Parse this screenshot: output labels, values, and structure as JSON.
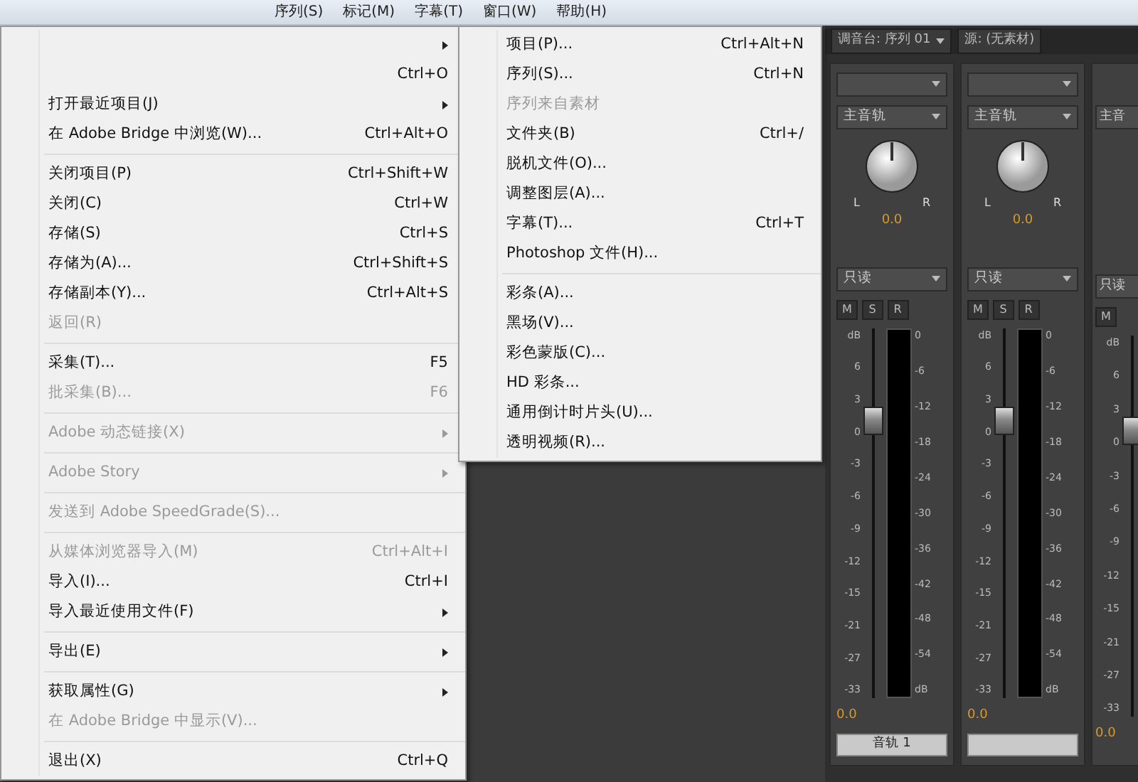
{
  "menu_bar": [
    {
      "label": "序列(S)"
    },
    {
      "label": "标记(M)"
    },
    {
      "label": "字幕(T)"
    },
    {
      "label": "窗口(W)"
    },
    {
      "label": "帮助(H)"
    }
  ],
  "file_menu": {
    "items": [
      {
        "kind": "item",
        "submenu": true,
        "disabled": false
      },
      {
        "kind": "item",
        "shortcut": "Ctrl+O",
        "submenu": false,
        "disabled": false
      },
      {
        "kind": "item",
        "label": "打开最近项目(J)",
        "submenu": true,
        "disabled": false
      },
      {
        "kind": "item",
        "label": "在 Adobe Bridge 中浏览(W)...",
        "shortcut": "Ctrl+Alt+O",
        "submenu": false,
        "disabled": false
      },
      {
        "kind": "separator"
      },
      {
        "kind": "item",
        "label": "关闭项目(P)",
        "shortcut": "Ctrl+Shift+W",
        "submenu": false,
        "disabled": false
      },
      {
        "kind": "item",
        "label": "关闭(C)",
        "shortcut": "Ctrl+W",
        "submenu": false,
        "disabled": false
      },
      {
        "kind": "item",
        "label": "存储(S)",
        "shortcut": "Ctrl+S",
        "submenu": false,
        "disabled": false
      },
      {
        "kind": "item",
        "label": "存储为(A)...",
        "shortcut": "Ctrl+Shift+S",
        "submenu": false,
        "disabled": false
      },
      {
        "kind": "item",
        "label": "存储副本(Y)...",
        "shortcut": "Ctrl+Alt+S",
        "submenu": false,
        "disabled": false
      },
      {
        "kind": "item",
        "label": "返回(R)",
        "submenu": false,
        "disabled": true
      },
      {
        "kind": "separator"
      },
      {
        "kind": "item",
        "label": "采集(T)...",
        "shortcut": "F5",
        "submenu": false,
        "disabled": false
      },
      {
        "kind": "item",
        "label": "批采集(B)...",
        "shortcut": "F6",
        "submenu": false,
        "disabled": true
      },
      {
        "kind": "separator"
      },
      {
        "kind": "item",
        "label": "Adobe 动态链接(X)",
        "submenu": true,
        "disabled": true
      },
      {
        "kind": "separator"
      },
      {
        "kind": "item",
        "label": "Adobe Story",
        "submenu": true,
        "disabled": true
      },
      {
        "kind": "separator"
      },
      {
        "kind": "item",
        "label": "发送到 Adobe SpeedGrade(S)...",
        "submenu": false,
        "disabled": true
      },
      {
        "kind": "separator"
      },
      {
        "kind": "item",
        "label": "从媒体浏览器导入(M)",
        "shortcut": "Ctrl+Alt+I",
        "submenu": false,
        "disabled": true
      },
      {
        "kind": "item",
        "label": "导入(I)...",
        "shortcut": "Ctrl+I",
        "submenu": false,
        "disabled": false
      },
      {
        "kind": "item",
        "label": "导入最近使用文件(F)",
        "submenu": true,
        "disabled": false
      },
      {
        "kind": "separator"
      },
      {
        "kind": "item",
        "label": "导出(E)",
        "submenu": true,
        "disabled": false
      },
      {
        "kind": "separator"
      },
      {
        "kind": "item",
        "label": "获取属性(G)",
        "submenu": true,
        "disabled": false
      },
      {
        "kind": "item",
        "label": "在 Adobe Bridge 中显示(V)...",
        "submenu": false,
        "disabled": true
      },
      {
        "kind": "separator"
      },
      {
        "kind": "item",
        "label": "退出(X)",
        "shortcut": "Ctrl+Q",
        "submenu": false,
        "disabled": false
      }
    ]
  },
  "new_submenu": {
    "items": [
      {
        "kind": "item",
        "label": "项目(P)...",
        "shortcut": "Ctrl+Alt+N",
        "disabled": false
      },
      {
        "kind": "item",
        "label": "序列(S)...",
        "shortcut": "Ctrl+N",
        "disabled": false
      },
      {
        "kind": "item",
        "label": "序列来自素材",
        "disabled": true
      },
      {
        "kind": "item",
        "label": "文件夹(B)",
        "shortcut": "Ctrl+/",
        "disabled": false
      },
      {
        "kind": "item",
        "label": "脱机文件(O)...",
        "disabled": false
      },
      {
        "kind": "item",
        "label": "调整图层(A)...",
        "disabled": false
      },
      {
        "kind": "item",
        "label": "字幕(T)...",
        "shortcut": "Ctrl+T",
        "disabled": false
      },
      {
        "kind": "item",
        "label": "Photoshop 文件(H)...",
        "disabled": false
      },
      {
        "kind": "separator"
      },
      {
        "kind": "item",
        "label": "彩条(A)...",
        "disabled": false
      },
      {
        "kind": "item",
        "label": "黑场(V)...",
        "disabled": false
      },
      {
        "kind": "item",
        "label": "彩色蒙版(C)...",
        "disabled": false
      },
      {
        "kind": "item",
        "label": "HD 彩条...",
        "disabled": false
      },
      {
        "kind": "item",
        "label": "通用倒计时片头(U)...",
        "disabled": false
      },
      {
        "kind": "item",
        "label": "透明视频(R)...",
        "disabled": false
      }
    ]
  },
  "audio_mixer": {
    "title": "调音台: 序列 01",
    "source": "源: (无素材)",
    "channels": [
      {
        "kind": "full",
        "route": "主音轨",
        "pan_left": "L",
        "pan_right": "R",
        "pan_reading": "0.0",
        "mode": "只读",
        "buttons": [
          "M",
          "S",
          "R"
        ],
        "left_scale": [
          "dB",
          "6",
          "3",
          "0",
          "-3",
          "-6",
          "-9",
          "-12",
          "-15",
          "-21",
          "-27",
          "-33"
        ],
        "right_scale": [
          "0",
          "-6",
          "-12",
          "-18",
          "-24",
          "-30",
          "-36",
          "-42",
          "-48",
          "-54",
          "dB"
        ],
        "level": 0.75,
        "volume_reading": "0.0",
        "name": "音轨 1"
      },
      {
        "kind": "full",
        "route": "主音轨",
        "pan_left": "L",
        "pan_right": "R",
        "pan_reading": "0.0",
        "mode": "只读",
        "buttons": [
          "M",
          "S",
          "R"
        ],
        "left_scale": [
          "dB",
          "6",
          "3",
          "0",
          "-3",
          "-6",
          "-9",
          "-12",
          "-15",
          "-21",
          "-27",
          "-33"
        ],
        "right_scale": [
          "0",
          "-6",
          "-12",
          "-18",
          "-24",
          "-30",
          "-36",
          "-42",
          "-48",
          "-54",
          "dB"
        ],
        "level": 0.75,
        "volume_reading": "0.0"
      },
      {
        "kind": "partial",
        "route": "主音",
        "mode": "只读",
        "buttons": [
          "M"
        ],
        "left_scale": [
          "dB",
          "6",
          "3",
          "0",
          "-3",
          "-6",
          "-9",
          "-12",
          "-15",
          "-21",
          "-27",
          "-33"
        ],
        "level": 0.75,
        "volume_reading": "0.0"
      }
    ]
  }
}
